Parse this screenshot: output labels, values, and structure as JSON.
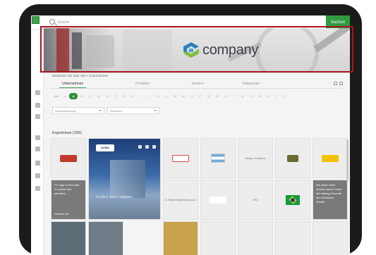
{
  "topbar": {
    "search_placeholder": "Suche",
    "search_button": "Suchen"
  },
  "banner": {
    "logo_text": "company",
    "colors": {
      "frame": "#a8141e",
      "logo_mark_blue": "#2a7fbf",
      "logo_mark_green": "#7bbf3a"
    }
  },
  "sidebar": {
    "items": [
      {
        "icon": "home-icon",
        "active": false
      },
      {
        "icon": "building-icon",
        "active": true
      },
      {
        "icon": "person-icon",
        "active": false
      },
      {
        "icon": "bag-icon",
        "active": false
      },
      {
        "icon": "chart-icon",
        "active": false
      },
      {
        "icon": "wallet-icon",
        "active": false
      },
      {
        "icon": "lock-icon",
        "active": false
      },
      {
        "icon": "tool-icon",
        "active": false
      },
      {
        "icon": "gear-icon",
        "active": false
      }
    ]
  },
  "breadcrumb": "Marktplatz der Idee Alle  >  Unternehmen",
  "tabs": [
    {
      "label": "Unternehmen",
      "active": true
    },
    {
      "label": "Produkte",
      "active": false
    },
    {
      "label": "Marken",
      "active": false
    },
    {
      "label": "Kategorien",
      "active": false
    }
  ],
  "alphabet": [
    "Alle",
    "#",
    "A",
    "B",
    "C",
    "D",
    "E",
    "F",
    "G",
    "H",
    "I",
    "J",
    "K",
    "L",
    "M",
    "N",
    "O",
    "P",
    "Q",
    "R",
    "S",
    "T",
    "U",
    "V",
    "W",
    "X",
    "Y",
    "Z"
  ],
  "alphabet_selected": "A",
  "filters": {
    "country": "Niederlassungen",
    "sector": "Branchen"
  },
  "results_title": "Ergebnisse (336)",
  "featured": {
    "logo": "AUMA",
    "name": "A.U.M.A. S.p.A. Analysen"
  },
  "cells": {
    "c1": "",
    "c2": "",
    "c3": "",
    "c4": "Steigo Solutions",
    "c5": "",
    "c6": "",
    "dark1": "Pr Logo is here with 2x advert and admitted...",
    "dark1_more": "Preview list",
    "r2c3": "A. Albee Engineering Ltd.",
    "r2c5": "SKZ",
    "dark2": "Sie lieben mein suchen worst? Dann die entlang Fund die den Electronic Gesell..."
  }
}
